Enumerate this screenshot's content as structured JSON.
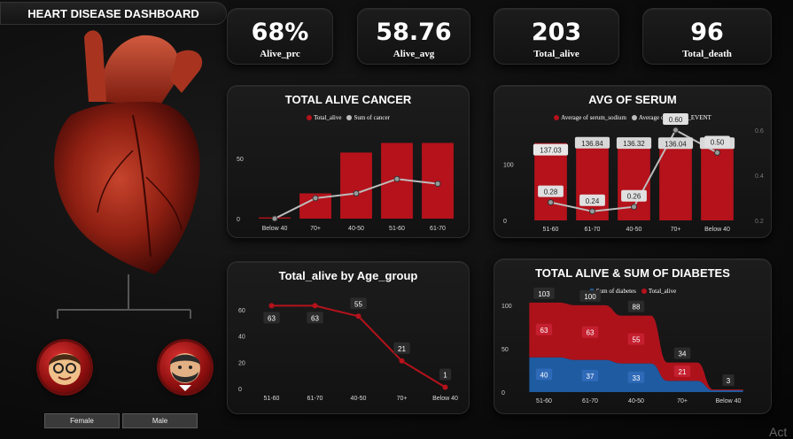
{
  "dashboard": {
    "title": "HEART DISEASE DASHBOARD"
  },
  "kpis": [
    {
      "value": "68%",
      "label": "Alive_prc"
    },
    {
      "value": "58.76",
      "label": "Alive_avg"
    },
    {
      "value": "203",
      "label": "Total_alive"
    },
    {
      "value": "96",
      "label": "Total_death"
    }
  ],
  "gender": {
    "female": "Female",
    "male": "Male"
  },
  "watermark": "Act",
  "colors": {
    "red": "#b5121b",
    "grey": "#bdbdbd",
    "blue": "#1f5fa8"
  },
  "chart_data": [
    {
      "id": "cancer",
      "type": "bar",
      "title": "TOTAL ALIVE CANCER",
      "legend": [
        "Total_alive",
        "Sum of cancer"
      ],
      "categories": [
        "Below 40",
        "70+",
        "40-50",
        "51-60",
        "61-70"
      ],
      "series": [
        {
          "name": "Total_alive",
          "type": "bar",
          "values": [
            1,
            21,
            55,
            63,
            63
          ]
        },
        {
          "name": "Sum of cancer",
          "type": "line",
          "values": [
            0,
            17,
            21,
            33,
            29
          ]
        }
      ],
      "yticks": [
        0,
        50
      ],
      "ylim": [
        0,
        70
      ]
    },
    {
      "id": "serum",
      "type": "bar",
      "title": "AVG OF SERUM",
      "legend": [
        "Average of serum_sodium",
        "Average of DEATH_EVENT"
      ],
      "categories": [
        "51-60",
        "61-70",
        "40-50",
        "70+",
        "Below 40"
      ],
      "series": [
        {
          "name": "Average of serum_sodium",
          "type": "bar",
          "values": [
            137.03,
            136.84,
            136.32,
            136.04,
            136.0
          ],
          "labels": [
            "137.03",
            "136.84",
            "136.32",
            "136.04",
            "136.00"
          ]
        },
        {
          "name": "Average of DEATH_EVENT",
          "type": "line",
          "values": [
            0.28,
            0.24,
            0.26,
            0.6,
            0.5
          ],
          "labels": [
            "0.28",
            "0.24",
            "0.26",
            "0.60",
            "0.50"
          ]
        }
      ],
      "yticks": [
        0,
        100
      ],
      "ylim": [
        0,
        160
      ],
      "y2ticks": [
        "0.2",
        "0.4",
        "0.6"
      ],
      "y2lim": [
        0.2,
        0.6
      ]
    },
    {
      "id": "age",
      "type": "line",
      "title": "Total_alive by Age_group",
      "categories": [
        "51-60",
        "61-70",
        "40-50",
        "70+",
        "Below 40"
      ],
      "series": [
        {
          "name": "Total_alive",
          "values": [
            63,
            63,
            55,
            21,
            1
          ]
        }
      ],
      "yticks": [
        0,
        20,
        40,
        60
      ],
      "ylim": [
        0,
        68
      ]
    },
    {
      "id": "diabetes",
      "type": "area",
      "title": "TOTAL ALIVE & SUM OF DIABETES",
      "legend": [
        "Sum of diabetes",
        "Total_alive"
      ],
      "categories": [
        "51-60",
        "61-70",
        "40-50",
        "70+",
        "Below 40"
      ],
      "series": [
        {
          "name": "Sum of diabetes",
          "values": [
            40,
            37,
            33,
            13,
            2
          ],
          "labels": [
            "40",
            "37",
            "33",
            "",
            ""
          ]
        },
        {
          "name": "Total_alive",
          "values": [
            63,
            63,
            55,
            21,
            1
          ],
          "labels": [
            "63",
            "63",
            "55",
            "21",
            ""
          ]
        }
      ],
      "totals": [
        "103",
        "100",
        "88",
        "34",
        "3"
      ],
      "yticks": [
        0,
        50,
        100
      ],
      "ylim": [
        0,
        110
      ]
    }
  ]
}
